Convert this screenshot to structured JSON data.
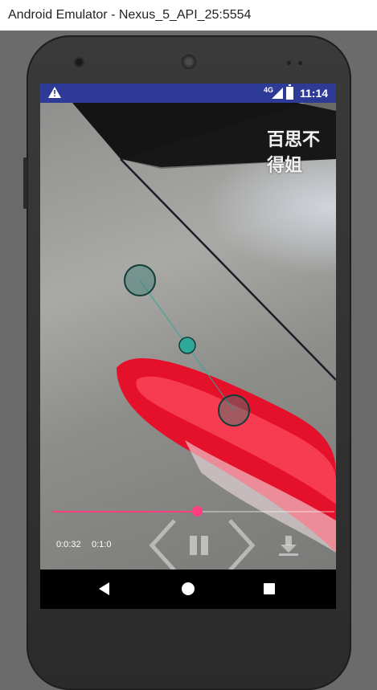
{
  "window": {
    "title": "Android Emulator - Nexus_5_API_25:5554"
  },
  "status_bar": {
    "time": "11:14",
    "network": "4G",
    "warning_icon": "warning-icon"
  },
  "video": {
    "watermark": "百思不得姐",
    "progress_fraction": 0.51,
    "current_time": "0:0:32",
    "total_time": "0:1:0"
  },
  "controls": {
    "prev_icon": "chevron-left-icon",
    "pause_icon": "pause-icon",
    "next_icon": "chevron-right-icon",
    "download_icon": "download-icon"
  },
  "nav_bar": {
    "back": "back-icon",
    "home": "home-icon",
    "recents": "recents-icon"
  },
  "colors": {
    "status_bar": "#2d3b96",
    "accent": "#ff3f7f",
    "marker": "#2fa89a"
  }
}
